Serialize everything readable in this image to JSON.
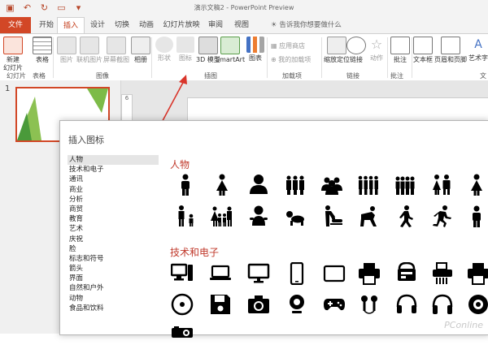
{
  "window": {
    "title": "演示文稿2 - PowerPoint Preview"
  },
  "tabs": [
    {
      "label": "文件"
    },
    {
      "label": "开始"
    },
    {
      "label": "插入"
    },
    {
      "label": "设计"
    },
    {
      "label": "切换"
    },
    {
      "label": "动画"
    },
    {
      "label": "幻灯片放映"
    },
    {
      "label": "审阅"
    },
    {
      "label": "视图"
    }
  ],
  "tell_me": "告诉我你想要做什么",
  "ribbon": {
    "new_slide": "新建\n幻灯片",
    "table": "表格",
    "pictures": "图片",
    "online_pictures": "联机图片",
    "screenshot": "屏幕截图",
    "album": "相册",
    "shapes": "形状",
    "icons": "图标",
    "model3d": "3D 模型",
    "smartart": "SmartArt",
    "chart": "图表",
    "store": "应用商店",
    "myaddins": "我的加载项",
    "zoom": "缩放定位",
    "link": "链接",
    "action": "动作",
    "comment": "批注",
    "textbox": "文本框",
    "headerfooter": "页眉和页脚",
    "wordart": "艺术字",
    "groups": {
      "slides": "幻灯片",
      "tables": "表格",
      "images": "图像",
      "illustrations": "插图",
      "addins": "加载项",
      "links": "链接",
      "comments": "批注",
      "text": "文"
    }
  },
  "slide_number": "1",
  "ruler_mark": "6",
  "dialog": {
    "title": "插入图标",
    "categories": [
      "人物",
      "技术和电子",
      "通讯",
      "商业",
      "分析",
      "商贸",
      "教育",
      "艺术",
      "庆祝",
      "脸",
      "标志和符号",
      "箭头",
      "界面",
      "自然和户外",
      "动物",
      "食品和饮料"
    ],
    "selected_category": "人物",
    "sections": [
      {
        "title": "人物"
      },
      {
        "title": "技术和电子"
      }
    ]
  },
  "watermark": "PConline",
  "colors": {
    "accent": "#d24726",
    "section_title": "#c0392b"
  }
}
